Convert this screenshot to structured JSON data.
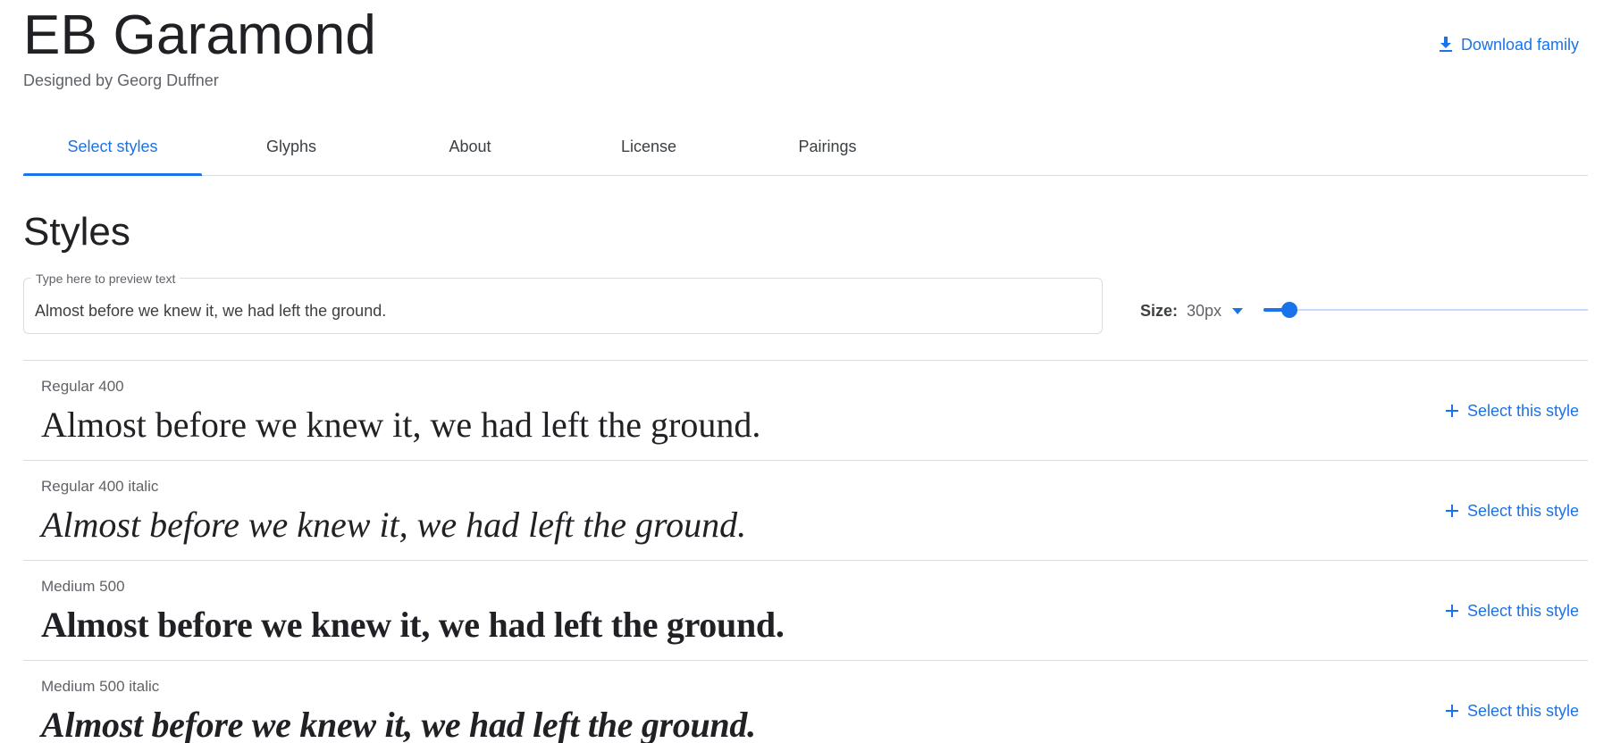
{
  "header": {
    "family_name": "EB Garamond",
    "designer": "Designed by Georg Duffner",
    "download_label": "Download family"
  },
  "tabs": [
    {
      "label": "Select styles",
      "active": true
    },
    {
      "label": "Glyphs",
      "active": false
    },
    {
      "label": "About",
      "active": false
    },
    {
      "label": "License",
      "active": false
    },
    {
      "label": "Pairings",
      "active": false
    }
  ],
  "styles_section": {
    "title": "Styles",
    "preview": {
      "label": "Type here to preview text",
      "value": "Almost before we knew it, we had left the ground."
    },
    "size": {
      "label": "Size:",
      "value": "30px",
      "slider_fraction": 0.08
    },
    "styles": [
      {
        "name": "Regular 400",
        "sample": "Almost before we knew it, we had left the ground.",
        "variant": "regular",
        "action": "Select this style"
      },
      {
        "name": "Regular 400 italic",
        "sample": "Almost before we knew it, we had left the ground.",
        "variant": "italic",
        "action": "Select this style"
      },
      {
        "name": "Medium 500",
        "sample": "Almost before we knew it, we had left the ground.",
        "variant": "medium",
        "action": "Select this style"
      },
      {
        "name": "Medium 500 italic",
        "sample": "Almost before we knew it, we had left the ground.",
        "variant": "medium-italic",
        "action": "Select this style"
      }
    ]
  },
  "colors": {
    "accent": "#1a73e8",
    "text_primary": "#202124",
    "text_secondary": "#5f6368",
    "divider": "#dadce0"
  },
  "icons": {
    "download": "download-icon",
    "plus": "plus-icon",
    "dropdown": "caret-down-icon"
  }
}
